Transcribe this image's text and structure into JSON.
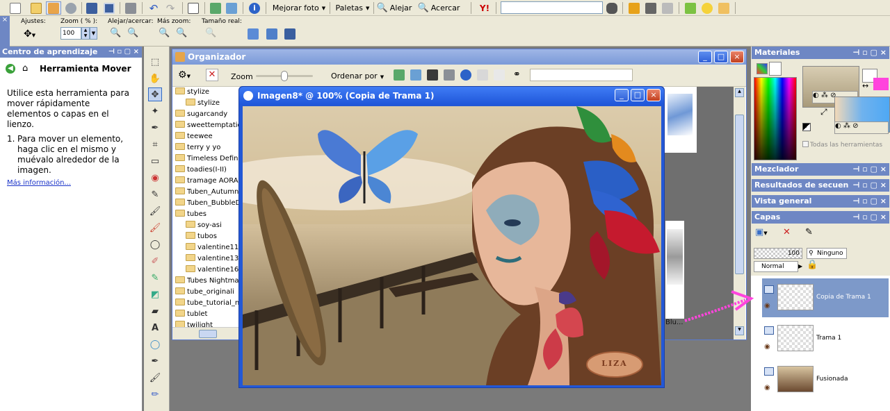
{
  "toolbar1": {
    "mejorar_foto": "Mejorar foto",
    "paletas": "Paletas",
    "alejar": "Alejar",
    "acercar": "Acercar"
  },
  "toolbar2": {
    "ajustes": "Ajustes:",
    "zoom_label": "Zoom ( % ):",
    "zoom_value": "100",
    "alejar_acercar": "Alejar/acercar:",
    "mas_zoom": "Más zoom:",
    "tamano_real": "Tamaño real:"
  },
  "learning": {
    "title": "Centro de aprendizaje",
    "heading": "Herramienta Mover",
    "body": "Utilice esta herramienta para mover rápidamente elementos o capas en el lienzo.",
    "step_num": "1.",
    "step": "Para mover un elemento, haga clic en el mismo y muévalo alrededor de la imagen.",
    "more": "Más información..."
  },
  "organizer": {
    "title": "Organizador",
    "zoom": "Zoom",
    "sort": "Ordenar por",
    "folders": [
      {
        "name": "stylize",
        "level": 0
      },
      {
        "name": "stylize",
        "level": 1
      },
      {
        "name": "sugarcandy",
        "level": 0
      },
      {
        "name": "sweettemptation",
        "level": 0
      },
      {
        "name": "teewee",
        "level": 0
      },
      {
        "name": "terry y yo",
        "level": 0
      },
      {
        "name": "Timeless Definition",
        "level": 0
      },
      {
        "name": "toadies(I-II)",
        "level": 0
      },
      {
        "name": "tramage AORA",
        "level": 0
      },
      {
        "name": "Tuben_AutumnMo",
        "level": 0
      },
      {
        "name": "Tuben_BubbleDre",
        "level": 0
      },
      {
        "name": "tubes",
        "level": 0
      },
      {
        "name": "soy-asi",
        "level": 1
      },
      {
        "name": "tubos",
        "level": 1
      },
      {
        "name": "valentine11",
        "level": 1
      },
      {
        "name": "valentine13",
        "level": 1
      },
      {
        "name": "valentine16",
        "level": 1
      },
      {
        "name": "Tubes Nightmare",
        "level": 0
      },
      {
        "name": "tube_originali",
        "level": 0
      },
      {
        "name": "tube_tutorial_nat",
        "level": 0
      },
      {
        "name": "tublet",
        "level": 0
      },
      {
        "name": "twilight",
        "level": 0
      }
    ],
    "thumb_label": "Blu..."
  },
  "image_window": {
    "title": "Imagen8* @ 100% (Copia de Trama 1)",
    "watermark": "LIZA"
  },
  "materials": {
    "title": "Materiales",
    "all_tools": "Todas las herramientas"
  },
  "panels": {
    "mixer": "Mezclador",
    "results": "Resultados de secuen",
    "overview": "Vista general",
    "layers": "Capas"
  },
  "layers": {
    "opacity": "100",
    "mask": "Ninguno",
    "blend": "Normal",
    "items": [
      {
        "name": "Copia de Trama 1"
      },
      {
        "name": "Trama 1"
      },
      {
        "name": "Fusionada"
      }
    ]
  },
  "colors": {
    "title_blue": "#6e87c4",
    "window_blue": "#2358d6",
    "pink": "#ff44dd"
  }
}
